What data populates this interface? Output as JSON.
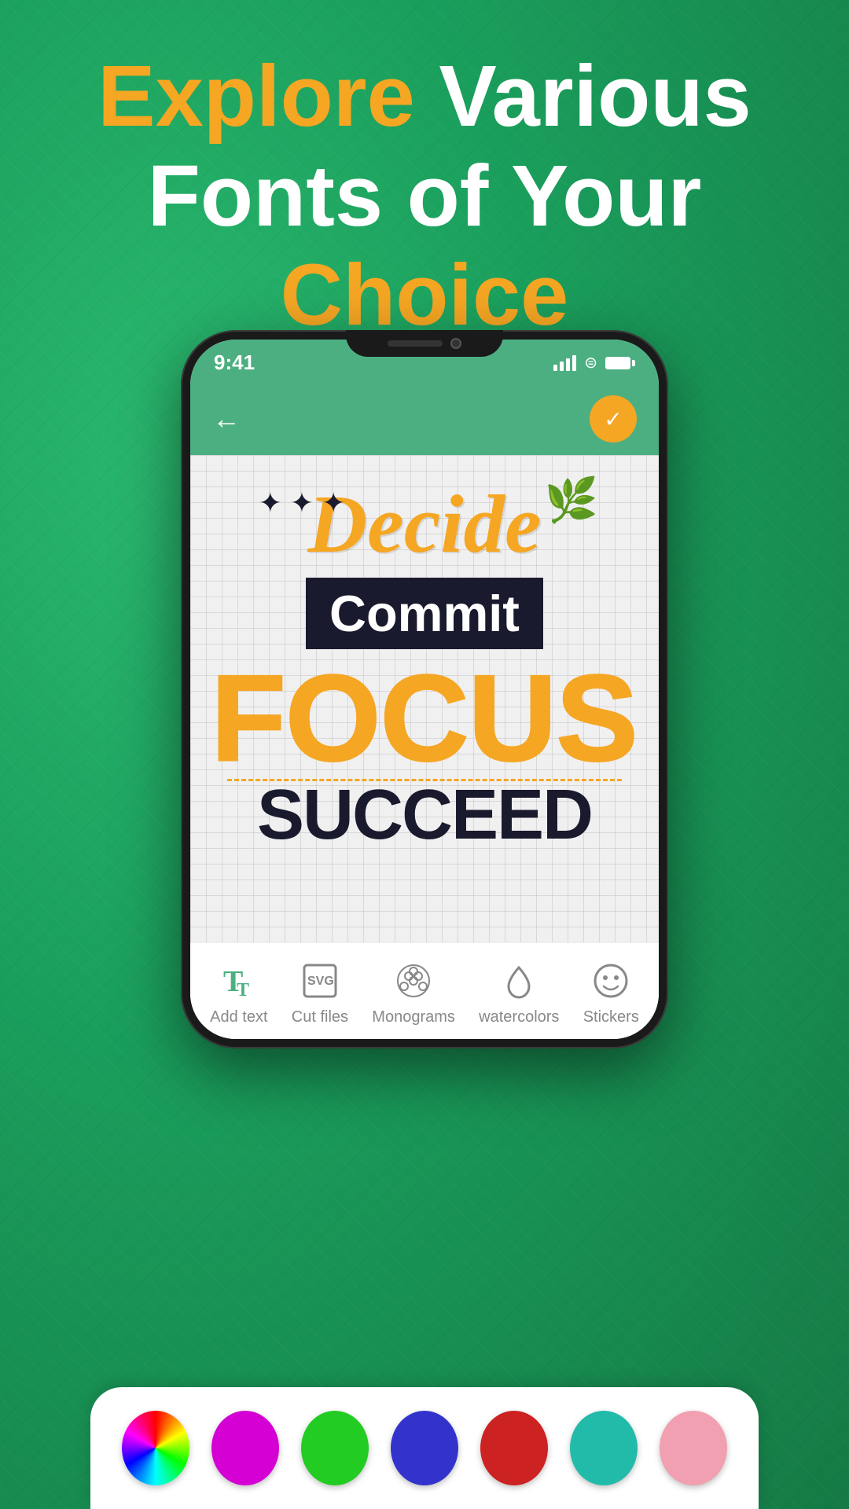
{
  "hero": {
    "line1_word1": "Explore",
    "line1_word2": "Various",
    "line2": "Fonts of Your",
    "line3": "Choice"
  },
  "status_bar": {
    "time": "9:41"
  },
  "header": {
    "back_label": "←",
    "check_label": "✓"
  },
  "canvas": {
    "word1": "Decide",
    "decoration": "✤ ✦ ❋",
    "word2": "Commit",
    "word3": "Focus",
    "word4": "Succeed"
  },
  "toolbar": {
    "items": [
      {
        "label": "Add text",
        "icon_name": "text-icon"
      },
      {
        "label": "Cut files",
        "icon_name": "cut-files-icon"
      },
      {
        "label": "Monograms",
        "icon_name": "monograms-icon"
      },
      {
        "label": "watercolors",
        "icon_name": "watercolors-icon"
      },
      {
        "label": "Stickers",
        "icon_name": "stickers-icon"
      }
    ]
  },
  "palette": {
    "colors": [
      {
        "name": "color-wheel",
        "value": "wheel"
      },
      {
        "name": "magenta",
        "value": "#d400d4"
      },
      {
        "name": "green",
        "value": "#22cc22"
      },
      {
        "name": "blue",
        "value": "#3333cc"
      },
      {
        "name": "red",
        "value": "#cc2222"
      },
      {
        "name": "teal",
        "value": "#22bbaa"
      },
      {
        "name": "pink",
        "value": "#f0a0b0"
      }
    ]
  }
}
